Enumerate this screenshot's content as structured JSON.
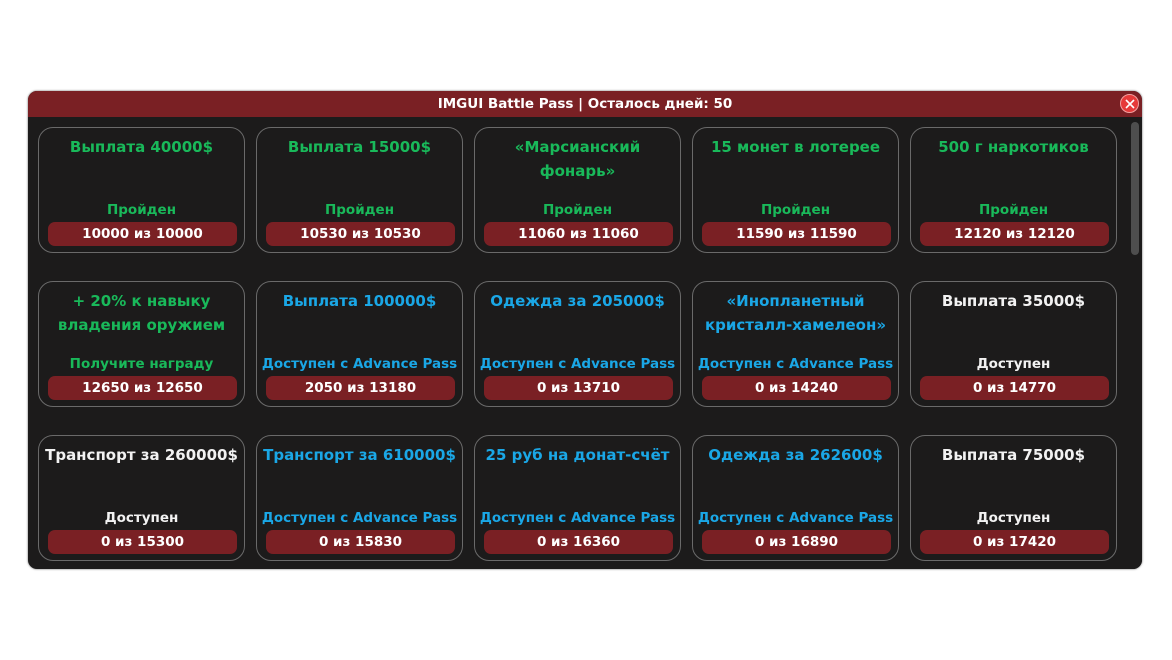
{
  "window": {
    "title": "IMGUI Battle Pass | Осталось дней: 50",
    "close_icon": "close-icon"
  },
  "colors": {
    "green": "#19b95a",
    "blue": "#1aa7e6",
    "white": "#f2f2f2",
    "accent": "#7a2024",
    "background": "#1c1b1b"
  },
  "rows": [
    [
      {
        "title": "Выплата 40000$",
        "status": "Пройден",
        "progress": "10000 из 10000",
        "title_color": "green",
        "status_color": "green"
      },
      {
        "title": "Выплата 15000$",
        "status": "Пройден",
        "progress": "10530 из 10530",
        "title_color": "green",
        "status_color": "green"
      },
      {
        "title": "«Марсианский фонарь»",
        "status": "Пройден",
        "progress": "11060 из 11060",
        "title_color": "green",
        "status_color": "green"
      },
      {
        "title": "15 монет в лотерее",
        "status": "Пройден",
        "progress": "11590 из 11590",
        "title_color": "green",
        "status_color": "green"
      },
      {
        "title": "500 г наркотиков",
        "status": "Пройден",
        "progress": "12120 из 12120",
        "title_color": "green",
        "status_color": "green"
      }
    ],
    [
      {
        "title": "+ 20% к навыку\nвладения оружием",
        "status": "Получите награду",
        "progress": "12650 из 12650",
        "title_color": "green",
        "status_color": "green"
      },
      {
        "title": "Выплата 100000$",
        "status": "Доступен с Advance Pass",
        "progress": "2050 из 13180",
        "title_color": "blue",
        "status_color": "blue"
      },
      {
        "title": "Одежда за 205000$",
        "status": "Доступен с Advance Pass",
        "progress": "0 из 13710",
        "title_color": "blue",
        "status_color": "blue"
      },
      {
        "title": "«Инопланетный\nкристалл-хамелеон»",
        "status": "Доступен с Advance Pass",
        "progress": "0 из 14240",
        "title_color": "blue",
        "status_color": "blue"
      },
      {
        "title": "Выплата 35000$",
        "status": "Доступен",
        "progress": "0 из 14770",
        "title_color": "white",
        "status_color": "white"
      }
    ],
    [
      {
        "title": "Транспорт за 260000$",
        "status": "Доступен",
        "progress": "0 из 15300",
        "title_color": "white",
        "status_color": "white"
      },
      {
        "title": "Транспорт за 610000$",
        "status": "Доступен с Advance Pass",
        "progress": "0 из 15830",
        "title_color": "blue",
        "status_color": "blue"
      },
      {
        "title": "25 руб на донат-счёт",
        "status": "Доступен с Advance Pass",
        "progress": "0 из 16360",
        "title_color": "blue",
        "status_color": "blue"
      },
      {
        "title": "Одежда за 262600$",
        "status": "Доступен с Advance Pass",
        "progress": "0 из 16890",
        "title_color": "blue",
        "status_color": "blue"
      },
      {
        "title": "Выплата 75000$",
        "status": "Доступен",
        "progress": "0 из 17420",
        "title_color": "white",
        "status_color": "white"
      }
    ]
  ]
}
